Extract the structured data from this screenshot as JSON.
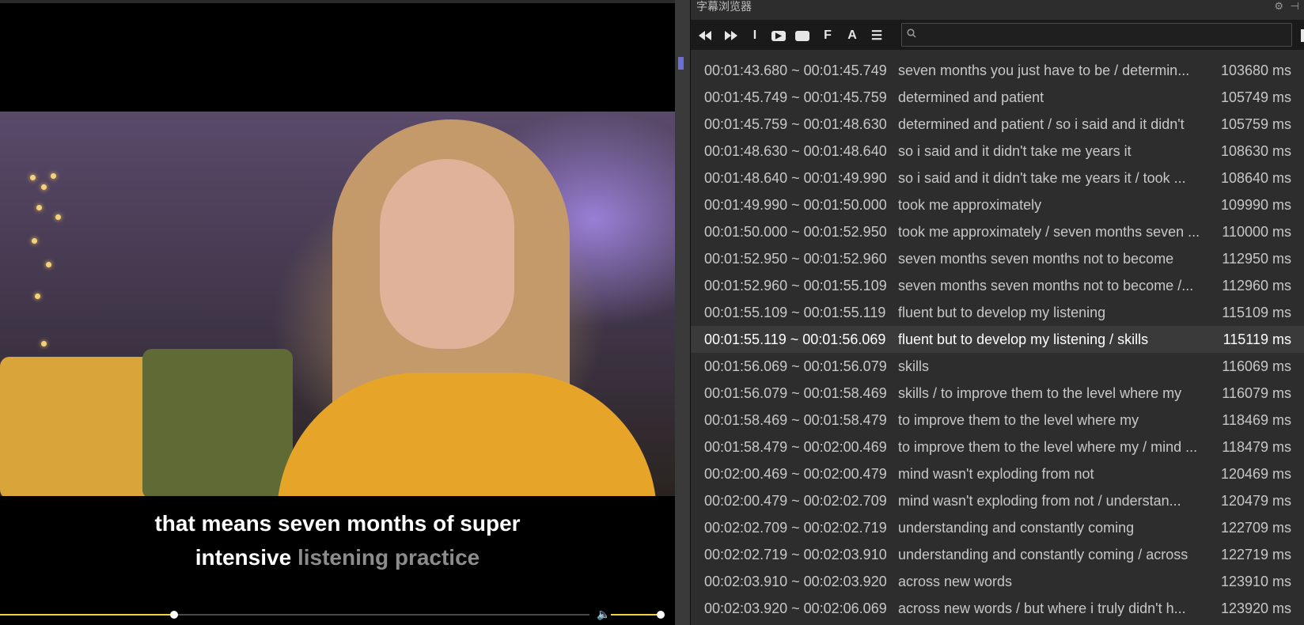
{
  "subtitle": {
    "line1": "that means seven months of super",
    "line2_spoken": "intensive",
    "line2_upcoming": "listening practice"
  },
  "player": {
    "seek_progress": 0.295,
    "volume_level": 0.95,
    "volume_icon": "speaker-icon"
  },
  "panel": {
    "title": "字幕浏览器",
    "settings_icon": "gear-icon",
    "pin_icon": "pin-icon",
    "toolbar": {
      "buttons": [
        "rewind-icon",
        "fast-forward-icon",
        "text-cursor-icon",
        "play-clip-icon",
        "subtitle-box-icon",
        "font-icon",
        "anchor-text-icon",
        "menu-icon"
      ],
      "labels": {
        "text_cursor": "I",
        "font": "F",
        "anchor": "A",
        "menu": "☰"
      }
    },
    "search": {
      "value": "",
      "placeholder": ""
    }
  },
  "subtitles": [
    {
      "time": "00:01:43.680 ~ 00:01:45.749",
      "text": "seven months you just have to be / determin...",
      "ms": "103680 ms"
    },
    {
      "time": "00:01:45.749 ~ 00:01:45.759",
      "text": "determined and patient",
      "ms": "105749 ms"
    },
    {
      "time": "00:01:45.759 ~ 00:01:48.630",
      "text": "determined and patient / so i said and it didn't",
      "ms": "105759 ms"
    },
    {
      "time": "00:01:48.630 ~ 00:01:48.640",
      "text": "so i said and it didn't take me years it",
      "ms": "108630 ms"
    },
    {
      "time": "00:01:48.640 ~ 00:01:49.990",
      "text": "so i said and it didn't take me years it / took ...",
      "ms": "108640 ms"
    },
    {
      "time": "00:01:49.990 ~ 00:01:50.000",
      "text": "took me approximately",
      "ms": "109990 ms"
    },
    {
      "time": "00:01:50.000 ~ 00:01:52.950",
      "text": "took me approximately / seven months seven ...",
      "ms": "110000 ms"
    },
    {
      "time": "00:01:52.950 ~ 00:01:52.960",
      "text": "seven months seven months not to become",
      "ms": "112950 ms"
    },
    {
      "time": "00:01:52.960 ~ 00:01:55.109",
      "text": "seven months seven months not to become /...",
      "ms": "112960 ms"
    },
    {
      "time": "00:01:55.109 ~ 00:01:55.119",
      "text": "fluent but to develop my listening",
      "ms": "115109 ms"
    },
    {
      "time": "00:01:55.119 ~ 00:01:56.069",
      "text": "fluent but to develop my listening / skills",
      "ms": "115119 ms",
      "active": true
    },
    {
      "time": "00:01:56.069 ~ 00:01:56.079",
      "text": "skills",
      "ms": "116069 ms"
    },
    {
      "time": "00:01:56.079 ~ 00:01:58.469",
      "text": "skills / to improve them to the level where my",
      "ms": "116079 ms"
    },
    {
      "time": "00:01:58.469 ~ 00:01:58.479",
      "text": "to improve them to the level where my",
      "ms": "118469 ms"
    },
    {
      "time": "00:01:58.479 ~ 00:02:00.469",
      "text": "to improve them to the level where my / mind ...",
      "ms": "118479 ms"
    },
    {
      "time": "00:02:00.469 ~ 00:02:00.479",
      "text": "mind wasn't exploding from not",
      "ms": "120469 ms"
    },
    {
      "time": "00:02:00.479 ~ 00:02:02.709",
      "text": "mind wasn't exploding from not / understan...",
      "ms": "120479 ms"
    },
    {
      "time": "00:02:02.709 ~ 00:02:02.719",
      "text": "understanding and constantly coming",
      "ms": "122709 ms"
    },
    {
      "time": "00:02:02.719 ~ 00:02:03.910",
      "text": "understanding and constantly coming / across",
      "ms": "122719 ms"
    },
    {
      "time": "00:02:03.910 ~ 00:02:03.920",
      "text": "across new words",
      "ms": "123910 ms"
    },
    {
      "time": "00:02:03.920 ~ 00:02:06.069",
      "text": "across new words / but where i truly didn't h...",
      "ms": "123920 ms"
    }
  ],
  "colors": {
    "accent": "#f2d23c",
    "active_row": "#3a3a3a",
    "upcoming_text": "#8c8c8c"
  }
}
